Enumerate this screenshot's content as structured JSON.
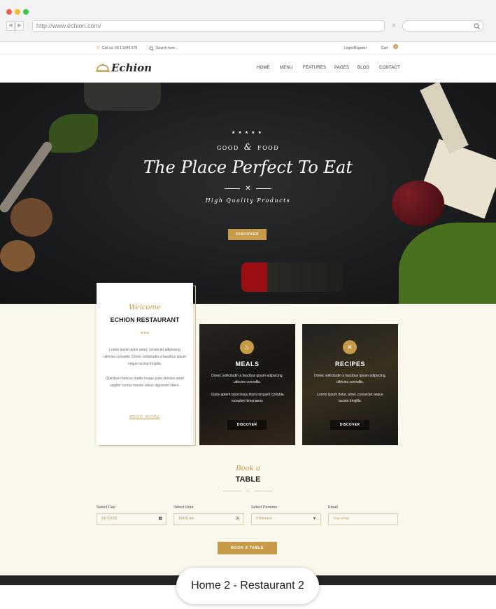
{
  "browser": {
    "url": "http://www.echion.com/"
  },
  "topbar": {
    "phone": "Call us: 00 1 2345 678",
    "search_placeholder": "Search here...",
    "login": "Login/Register",
    "cart": "Cart",
    "cart_count": "0"
  },
  "header": {
    "logo": "Echion",
    "nav": [
      "HOME",
      "MENU",
      "FEATURES",
      "PAGES",
      "BLOG",
      "CONTACT"
    ]
  },
  "hero": {
    "kicker_left": "GOOD",
    "kicker_amp": "&",
    "kicker_right": "FOOD",
    "title": "The Place Perfect To Eat",
    "tagline": "High Quality Products",
    "button": "DISCOVER"
  },
  "welcome": {
    "script": "Welcome",
    "title": "ECHION RESTAURANT",
    "para1": "Lorem ipsum dolor amet, consectet adipiscing ultricies convallis. Donec sollicitudin a faucibus ipsum neque lacinia fringilla.",
    "para2": "Quinibus rhoncus mattis neque justo ultricies amet sagittis cursus mauris varius dignissim libero.",
    "link": "READ MORE"
  },
  "cards": [
    {
      "title": "MEALS",
      "text1": "Donec sollicitudin a faucibus ipsum adipiscing, ultricies convallis.",
      "text2": "Class aptent taxociosqu litora torquent conubia inceptos himenaeos",
      "button": "DISCOVER",
      "icon": "cloche-icon"
    },
    {
      "title": "RECIPES",
      "text1": "Donec sollicitudin a faucibus ipsum adipiscing, ultricies convallis.",
      "text2": "Lorem ipsum dolor, amet, consectet neque lacinia fringilla.",
      "button": "DISCOVER",
      "icon": "fork-knife-icon"
    }
  ],
  "booking": {
    "script": "Book a",
    "title": "TABLE",
    "day_label": "Select Day",
    "day_value": "24/7/2016",
    "hour_label": "Select Hour",
    "hour_value": "10h00 am",
    "persons_label": "Select Persons",
    "persons_value": "2 Persons",
    "email_label": "Email",
    "email_placeholder": "Your email",
    "button": "BOOK A TABLE"
  },
  "caption": "Home 2 - Restaurant 2",
  "colors": {
    "accent": "#c69a48",
    "cream": "#faf7ec",
    "dark": "#1c1d1f"
  }
}
